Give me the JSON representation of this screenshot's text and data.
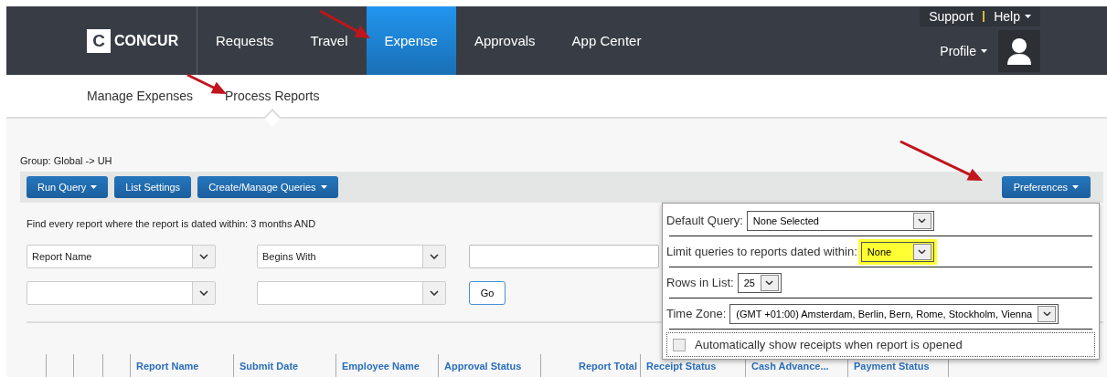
{
  "logo": {
    "mark": "C",
    "name": "CONCUR"
  },
  "nav": [
    {
      "label": "Requests",
      "selected": false
    },
    {
      "label": "Travel",
      "selected": false
    },
    {
      "label": "Expense",
      "selected": true
    },
    {
      "label": "Approvals",
      "selected": false
    },
    {
      "label": "App Center",
      "selected": false
    }
  ],
  "utility": {
    "support": "Support",
    "help": "Help",
    "profile": "Profile"
  },
  "subnav": [
    {
      "label": "Manage Expenses",
      "selected": false
    },
    {
      "label": "Process Reports",
      "selected": true
    }
  ],
  "group_label": "Group: Global -> UH",
  "toolbar": [
    {
      "label": "Run Query",
      "dropdown": true
    },
    {
      "label": "List Settings",
      "dropdown": false
    },
    {
      "label": "Create/Manage Queries",
      "dropdown": true
    }
  ],
  "preferences_button": "Preferences",
  "filter": {
    "summary": "Find every report where the report is dated within: 3 months AND",
    "field": "Report Name",
    "operator": "Begins With",
    "go": "Go"
  },
  "table": {
    "columns": [
      "Report Name",
      "Submit Date",
      "Employee Name",
      "Approval Status",
      "Report Total",
      "Receipt Status",
      "Cash Advance...",
      "Payment Status"
    ]
  },
  "preferences": [
    {
      "kind": "select",
      "label": "Default Query:",
      "value": "None Selected",
      "highlighted": false
    },
    {
      "kind": "select",
      "label": "Limit queries to reports dated within:",
      "value": "None",
      "highlighted": true
    },
    {
      "kind": "select",
      "label": "Rows in List:",
      "value": "25",
      "highlighted": false
    },
    {
      "kind": "select",
      "label": "Time Zone:",
      "value": "(GMT +01:00) Amsterdam, Berlin, Bern, Rome, Stockholm, Vienna",
      "highlighted": false
    },
    {
      "kind": "checkbox",
      "label": "Automatically show receipts when report is opened",
      "checked": false
    }
  ]
}
